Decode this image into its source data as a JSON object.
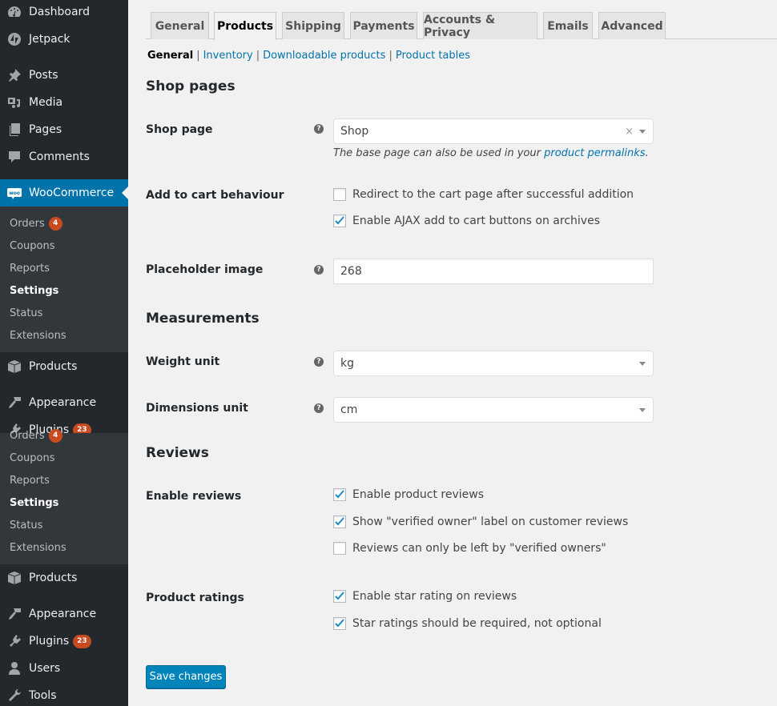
{
  "sidebar": {
    "top_items": [
      {
        "label": "Dashboard",
        "icon": "dashboard-icon"
      },
      {
        "label": "Jetpack",
        "icon": "jetpack-icon"
      },
      {
        "label": "Posts",
        "icon": "pin-icon"
      },
      {
        "label": "Media",
        "icon": "media-icon"
      },
      {
        "label": "Pages",
        "icon": "pages-icon"
      },
      {
        "label": "Comments",
        "icon": "comment-icon"
      }
    ],
    "woocommerce": {
      "label": "WooCommerce",
      "icon": "woo-icon",
      "icon_text": "woo"
    },
    "submenu": [
      {
        "label": "Orders",
        "badge": "4"
      },
      {
        "label": "Coupons"
      },
      {
        "label": "Reports"
      },
      {
        "label": "Settings",
        "current": true
      },
      {
        "label": "Status"
      },
      {
        "label": "Extensions"
      }
    ],
    "after_items": [
      {
        "label": "Products",
        "icon": "box-icon"
      },
      {
        "label": "Appearance",
        "icon": "brush-icon"
      },
      {
        "label": "Plugins",
        "icon": "plug-icon",
        "badge": "23"
      },
      {
        "label": "Users",
        "icon": "user-icon"
      },
      {
        "label": "Tools",
        "icon": "wrench-icon"
      }
    ]
  },
  "tabs": [
    {
      "label": "General"
    },
    {
      "label": "Products",
      "active": true
    },
    {
      "label": "Shipping"
    },
    {
      "label": "Payments"
    },
    {
      "label": "Accounts & Privacy"
    },
    {
      "label": "Emails"
    },
    {
      "label": "Advanced"
    }
  ],
  "subnav": {
    "current": "General",
    "links": [
      "Inventory",
      "Downloadable products",
      "Product tables"
    ],
    "separator": "|"
  },
  "sections": {
    "shop_pages": "Shop pages",
    "measurements": "Measurements",
    "reviews": "Reviews"
  },
  "fields": {
    "shop_page": {
      "label": "Shop page",
      "value": "Shop",
      "clear": "×",
      "desc_prefix": "The base page can also be used in your ",
      "desc_link": "product permalinks",
      "desc_suffix": "."
    },
    "add_to_cart": {
      "label": "Add to cart behaviour",
      "options": [
        {
          "label": "Redirect to the cart page after successful addition",
          "checked": false
        },
        {
          "label": "Enable AJAX add to cart buttons on archives",
          "checked": true
        }
      ]
    },
    "placeholder_image": {
      "label": "Placeholder image",
      "value": "268"
    },
    "weight_unit": {
      "label": "Weight unit",
      "value": "kg"
    },
    "dimensions_unit": {
      "label": "Dimensions unit",
      "value": "cm"
    },
    "enable_reviews": {
      "label": "Enable reviews",
      "options": [
        {
          "label": "Enable product reviews",
          "checked": true
        },
        {
          "label": "Show \"verified owner\" label on customer reviews",
          "checked": true
        },
        {
          "label": "Reviews can only be left by \"verified owners\"",
          "checked": false
        }
      ]
    },
    "product_ratings": {
      "label": "Product ratings",
      "options": [
        {
          "label": "Enable star rating on reviews",
          "checked": true
        },
        {
          "label": "Star ratings should be required, not optional",
          "checked": true
        }
      ]
    }
  },
  "help_tip": "?",
  "save_label": "Save changes",
  "colors": {
    "accent": "#0073aa",
    "button": "#0085ba",
    "badge": "#ca4a1f",
    "sidebar": "#23282d",
    "submenu": "#32373c"
  }
}
